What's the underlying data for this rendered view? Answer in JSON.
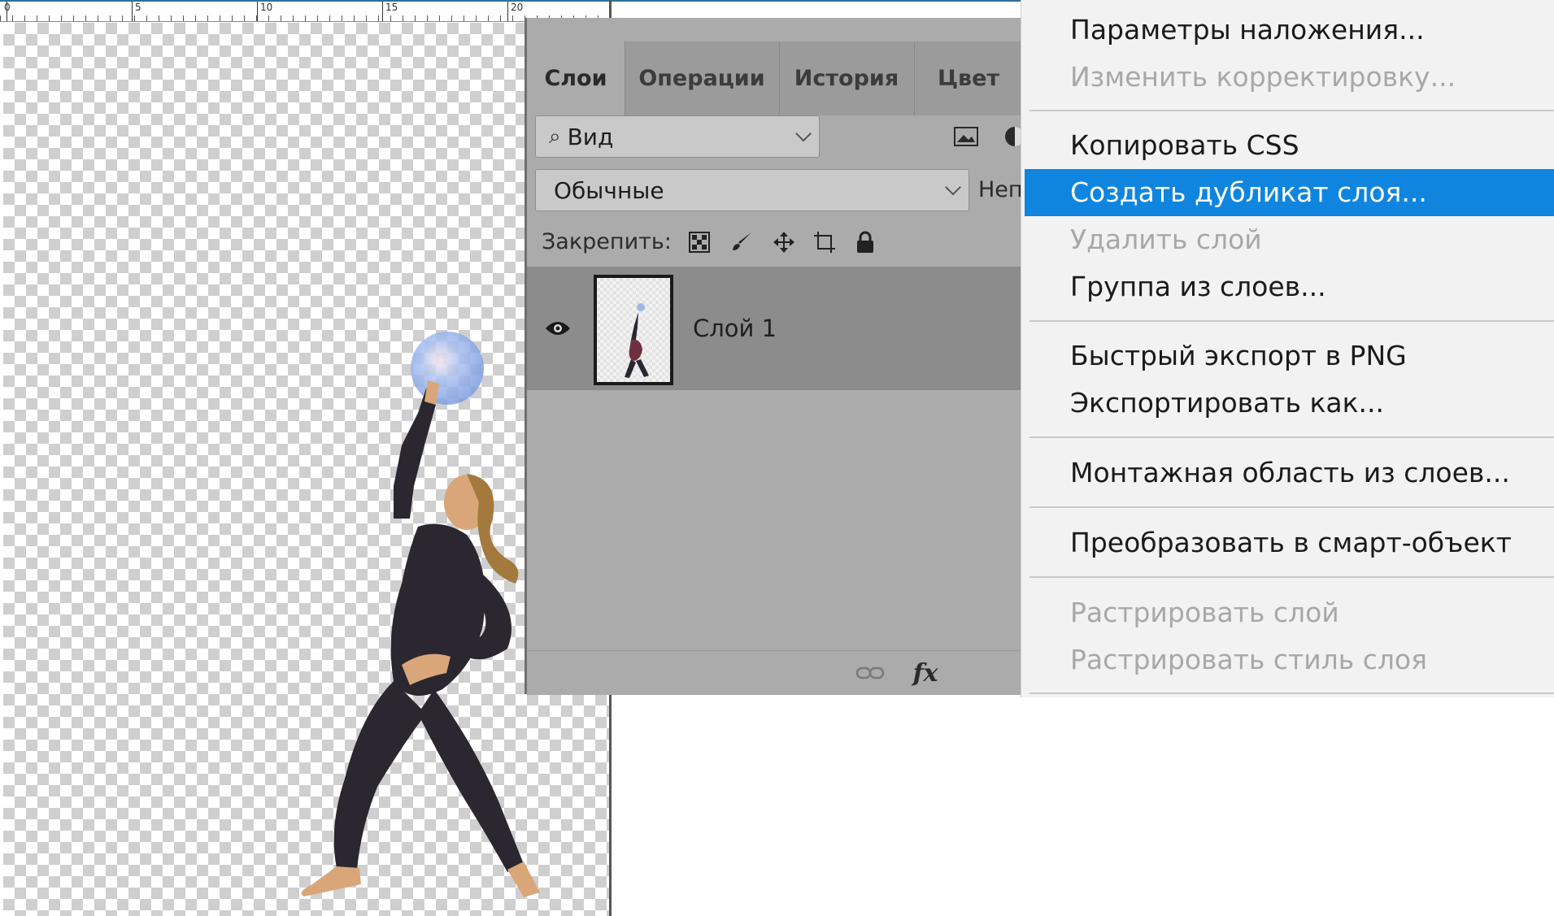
{
  "ruler": {
    "labels": [
      "0",
      "5",
      "10",
      "15",
      "20"
    ]
  },
  "layers_panel": {
    "tabs": [
      {
        "label": "Слои",
        "active": true
      },
      {
        "label": "Операции",
        "active": false
      },
      {
        "label": "История",
        "active": false
      },
      {
        "label": "Цвет",
        "active": false
      }
    ],
    "filter": {
      "label": "Вид"
    },
    "blend_mode": {
      "value": "Обычные"
    },
    "opacity_label_partial": "Неп",
    "lock_label": "Закрепить:",
    "layers": [
      {
        "name": "Слой 1",
        "visible": true
      }
    ]
  },
  "context_menu": {
    "items": [
      {
        "label": "Параметры наложения...",
        "disabled": false,
        "selected": false
      },
      {
        "label": "Изменить корректировку...",
        "disabled": true,
        "selected": false
      },
      {
        "label": "Копировать CSS",
        "disabled": false,
        "selected": false
      },
      {
        "label": "Создать дубликат слоя...",
        "disabled": false,
        "selected": true
      },
      {
        "label": "Удалить слой",
        "disabled": true,
        "selected": false
      },
      {
        "label": "Группа из слоев...",
        "disabled": false,
        "selected": false
      },
      {
        "label": "Быстрый экспорт в PNG",
        "disabled": false,
        "selected": false
      },
      {
        "label": "Экспортировать как...",
        "disabled": false,
        "selected": false
      },
      {
        "label": "Монтажная область из слоев...",
        "disabled": false,
        "selected": false
      },
      {
        "label": "Преобразовать в смарт-объект",
        "disabled": false,
        "selected": false
      },
      {
        "label": "Растрировать слой",
        "disabled": true,
        "selected": false
      },
      {
        "label": "Растрировать стиль слоя",
        "disabled": true,
        "selected": false
      }
    ]
  },
  "colors": {
    "selection": "#0f85e0",
    "panel_bg": "#ababab",
    "menu_bg": "#f2f2f2",
    "disabled_text": "#a8a8a8"
  }
}
